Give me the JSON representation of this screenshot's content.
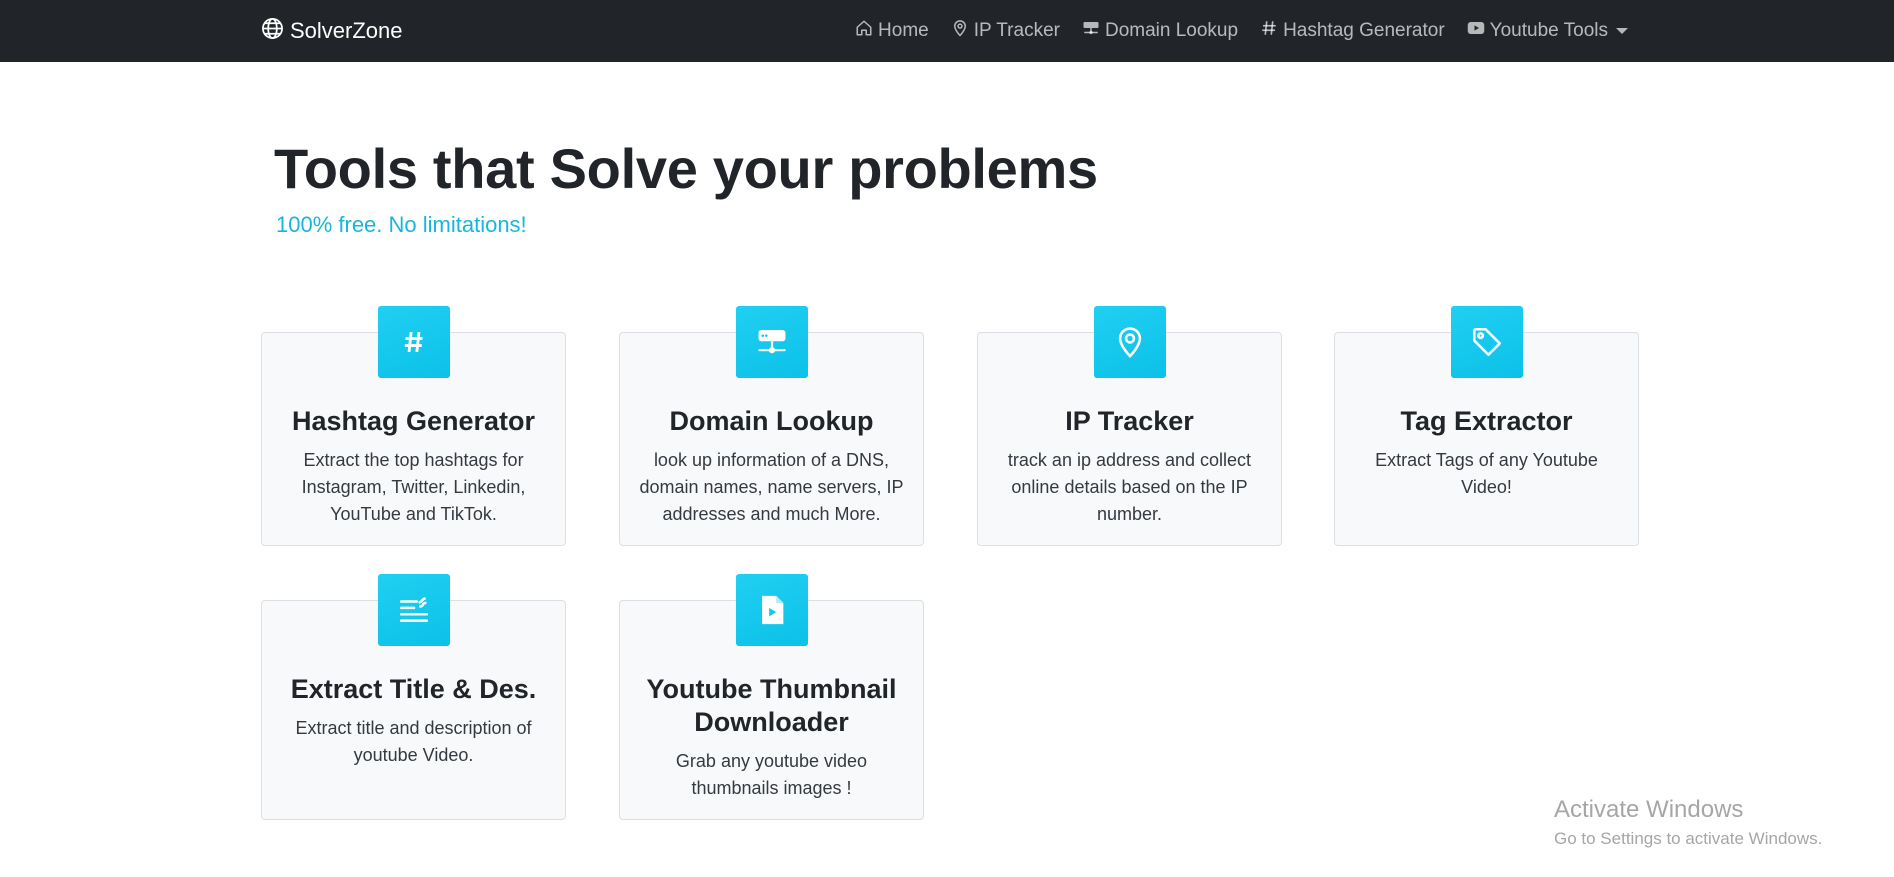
{
  "navbar": {
    "brand": "SolverZone",
    "items": [
      {
        "label": "Home",
        "icon": "home-icon"
      },
      {
        "label": "IP Tracker",
        "icon": "map-pin-icon"
      },
      {
        "label": "Domain Lookup",
        "icon": "server-icon"
      },
      {
        "label": "Hashtag Generator",
        "icon": "hash-icon"
      },
      {
        "label": "Youtube Tools",
        "icon": "youtube-icon"
      }
    ]
  },
  "hero": {
    "title": "Tools that Solve your problems",
    "subtitle": "100% free. No limitations!"
  },
  "cards": [
    {
      "title": "Hashtag Generator",
      "description": "Extract the top hashtags for Instagram, Twitter, Linkedin, YouTube and TikTok.",
      "icon": "hash-icon"
    },
    {
      "title": "Domain Lookup",
      "description": "look up information of a DNS, domain names, name servers, IP addresses and much More.",
      "icon": "server-icon"
    },
    {
      "title": "IP Tracker",
      "description": "track an ip address and collect online details based on the IP number.",
      "icon": "map-pin-icon"
    },
    {
      "title": "Tag Extractor",
      "description": "Extract Tags of any Youtube Video!",
      "icon": "tag-icon"
    },
    {
      "title": "Extract Title & Des.",
      "description": "Extract title and description of youtube Video.",
      "icon": "text-lines-icon"
    },
    {
      "title": "Youtube Thumbnail Downloader",
      "description": "Grab any youtube video thumbnails images !",
      "icon": "file-play-icon"
    }
  ],
  "watermark": {
    "title": "Activate Windows",
    "subtitle": "Go to Settings to activate Windows."
  },
  "colors": {
    "navbar_bg": "#212529",
    "accent": "#17b7dd",
    "icon_bg": "#15c6ee",
    "card_bg": "#f8f9fa"
  }
}
